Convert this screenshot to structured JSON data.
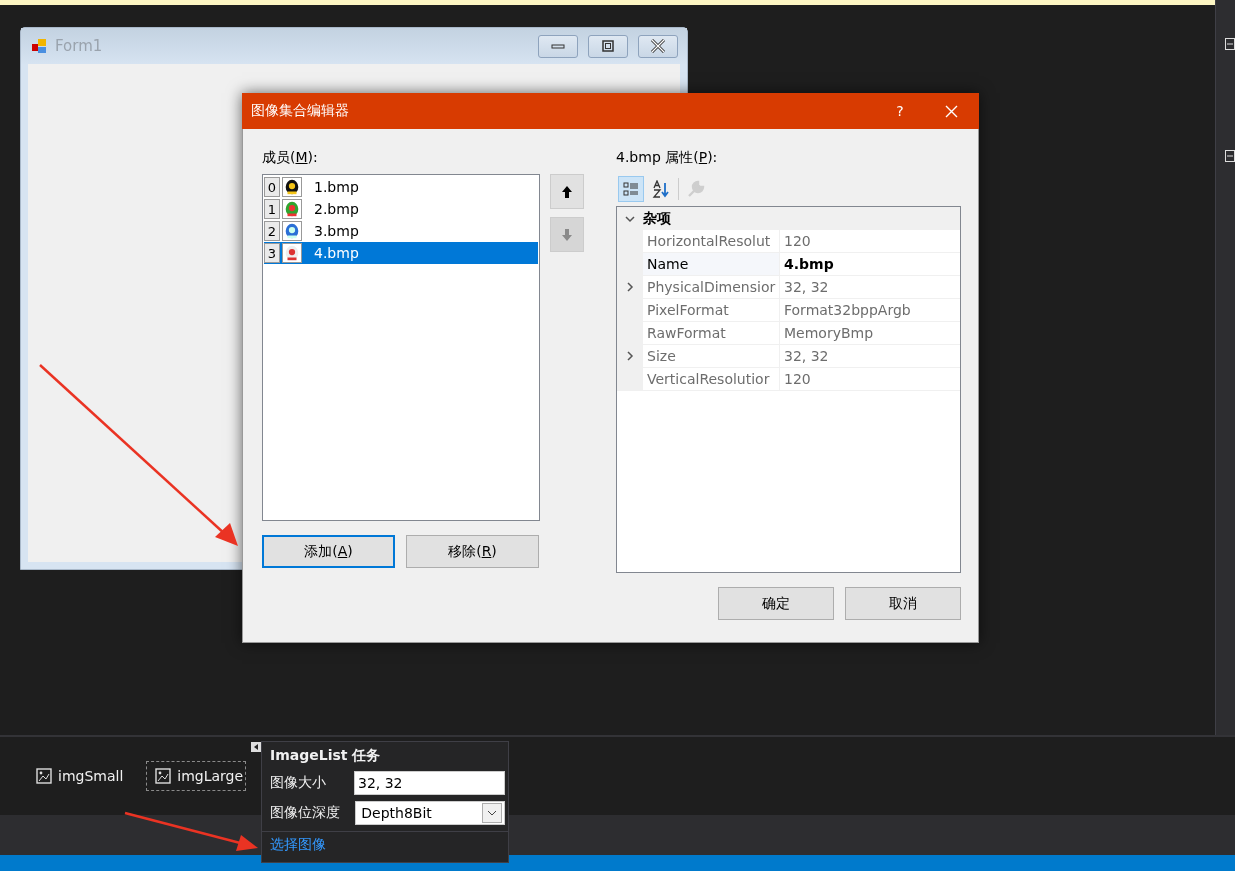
{
  "form": {
    "title": "Form1"
  },
  "dialog": {
    "title": "图像集合编辑器",
    "help": "?",
    "members_label": {
      "before": "成员(",
      "key": "M",
      "after": "):"
    },
    "members": [
      {
        "index": "0",
        "name": "1.bmp",
        "selected": false
      },
      {
        "index": "1",
        "name": "2.bmp",
        "selected": false
      },
      {
        "index": "2",
        "name": "3.bmp",
        "selected": false
      },
      {
        "index": "3",
        "name": "4.bmp",
        "selected": true
      }
    ],
    "move_buttons": [
      {
        "kind": "up",
        "disabled": false
      },
      {
        "kind": "down",
        "disabled": true
      }
    ],
    "add_button": {
      "before": "添加(",
      "key": "A",
      "after": ")",
      "focused": true
    },
    "remove_button": {
      "before": "移除(",
      "key": "R",
      "after": ")",
      "focused": false
    },
    "properties_label": {
      "before": "4.bmp 属性(",
      "key": "P",
      "after": "):"
    },
    "toolbar": [
      {
        "kind": "categorized",
        "selected": true,
        "disabled": false
      },
      {
        "kind": "alphabetical",
        "selected": false,
        "disabled": false
      },
      {
        "kind": "property-pages",
        "selected": false,
        "disabled": true
      }
    ],
    "category": {
      "name": "杂项",
      "expanded": true
    },
    "properties": [
      {
        "name": "HorizontalResolut",
        "value": "120",
        "readonly": true,
        "expandable": false,
        "modified": false
      },
      {
        "name": "Name",
        "value": "4.bmp",
        "readonly": false,
        "expandable": false,
        "modified": true
      },
      {
        "name": "PhysicalDimensior",
        "value": "32, 32",
        "readonly": true,
        "expandable": true,
        "modified": false
      },
      {
        "name": "PixelFormat",
        "value": "Format32bppArgb",
        "readonly": true,
        "expandable": false,
        "modified": false
      },
      {
        "name": "RawFormat",
        "value": "MemoryBmp",
        "readonly": true,
        "expandable": false,
        "modified": false
      },
      {
        "name": "Size",
        "value": "32, 32",
        "readonly": true,
        "expandable": true,
        "modified": false
      },
      {
        "name": "VerticalResolutior",
        "value": "120",
        "readonly": true,
        "expandable": false,
        "modified": false
      }
    ],
    "buttons": [
      "确定",
      "取消"
    ]
  },
  "tray": [
    {
      "name": "imgSmall",
      "selected": false
    },
    {
      "name": "imgLarge",
      "selected": true
    }
  ],
  "smart_tag": {
    "title": "ImageList 任务",
    "fields": [
      {
        "label": "图像大小",
        "kind": "text",
        "value": "32, 32"
      },
      {
        "label": "图像位深度",
        "kind": "dropdown",
        "value": "Depth8Bit"
      }
    ],
    "link": "选择图像"
  }
}
